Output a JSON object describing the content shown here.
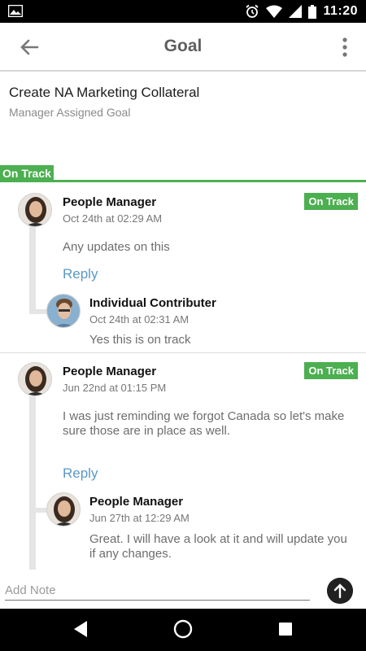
{
  "status_bar": {
    "time": "11:20",
    "icons": [
      "image-icon",
      "alarm-icon",
      "wifi-icon",
      "signal-icon",
      "battery-icon"
    ]
  },
  "app_bar": {
    "title": "Goal",
    "back_icon": "arrow-back-icon",
    "menu_icon": "more-vert-icon"
  },
  "goal": {
    "title": "Create NA Marketing Collateral",
    "subtitle": "Manager Assigned Goal",
    "status": "On Track"
  },
  "threads": [
    {
      "author": "People Manager",
      "date": "Oct 24th at 02:29 AM",
      "badge": "On Track",
      "message": "Any updates on this",
      "reply_label": "Reply",
      "replies": [
        {
          "author": "Individual Contributer",
          "date": "Oct 24th at 02:31 AM",
          "message": "Yes this is on track"
        }
      ]
    },
    {
      "author": "People Manager",
      "date": "Jun 22nd at 01:15 PM",
      "badge": "On Track",
      "message": "I was just reminding we forgot Canada so let's make sure those are in place as well.",
      "reply_label": "Reply",
      "replies": [
        {
          "author": "People Manager",
          "date": "Jun 27th at 12:29 AM",
          "message": "Great. I will have a look at it and will update you if any changes."
        }
      ]
    }
  ],
  "note": {
    "placeholder": "Add Note",
    "send_icon": "arrow-up-icon"
  },
  "colors": {
    "accent_green": "#4caf50",
    "reply_blue": "#5c98c4",
    "thread_line": "#e5e5e5"
  }
}
